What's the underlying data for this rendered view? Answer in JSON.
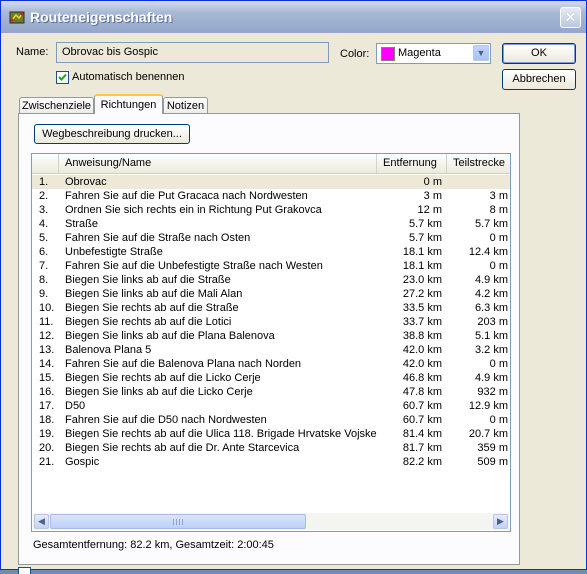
{
  "window": {
    "title": "Routeneigenschaften",
    "icon": "route-properties-icon",
    "close_icon": "close-icon"
  },
  "form": {
    "name_label": "Name:",
    "name_value": "Obrovac bis Gospic",
    "color_label": "Color:",
    "color_value": "Magenta",
    "color_swatch": "#ff00ff",
    "auto_name_label": "Automatisch benennen",
    "auto_name_checked": true
  },
  "buttons": {
    "ok": "OK",
    "cancel": "Abbrechen",
    "print": "Wegbeschreibung drucken..."
  },
  "tabs": [
    {
      "label": "Zwischenziele",
      "active": false
    },
    {
      "label": "Richtungen",
      "active": true
    },
    {
      "label": "Notizen",
      "active": false
    }
  ],
  "table": {
    "columns": [
      "Anweisung/Name",
      "Entfernung",
      "Teilstrecke"
    ],
    "rows": [
      {
        "num": "1.",
        "name": "Obrovac",
        "dist": "0 m",
        "leg": ""
      },
      {
        "num": "2.",
        "name": "Fahren Sie auf die Put Gracaca nach Nordwesten",
        "dist": "3 m",
        "leg": "3 m"
      },
      {
        "num": "3.",
        "name": "Ordnen Sie sich rechts ein in Richtung Put Grakovca",
        "dist": "12 m",
        "leg": "8 m"
      },
      {
        "num": "4.",
        "name": "Straße",
        "dist": "5.7 km",
        "leg": "5.7 km"
      },
      {
        "num": "5.",
        "name": "Fahren Sie auf die Straße nach Osten",
        "dist": "5.7 km",
        "leg": "0 m"
      },
      {
        "num": "6.",
        "name": "Unbefestigte Straße",
        "dist": "18.1 km",
        "leg": "12.4 km"
      },
      {
        "num": "7.",
        "name": "Fahren Sie auf die Unbefestigte Straße nach Westen",
        "dist": "18.1 km",
        "leg": "0 m"
      },
      {
        "num": "8.",
        "name": "Biegen Sie links ab auf die Straße",
        "dist": "23.0 km",
        "leg": "4.9 km"
      },
      {
        "num": "9.",
        "name": "Biegen Sie links ab auf die Mali Alan",
        "dist": "27.2 km",
        "leg": "4.2 km"
      },
      {
        "num": "10.",
        "name": "Biegen Sie rechts ab auf die Straße",
        "dist": "33.5 km",
        "leg": "6.3 km"
      },
      {
        "num": "11.",
        "name": "Biegen Sie rechts ab auf die Lotici",
        "dist": "33.7 km",
        "leg": "203 m"
      },
      {
        "num": "12.",
        "name": "Biegen Sie links ab auf die Plana Balenova",
        "dist": "38.8 km",
        "leg": "5.1 km"
      },
      {
        "num": "13.",
        "name": "Balenova Plana 5",
        "dist": "42.0 km",
        "leg": "3.2 km"
      },
      {
        "num": "14.",
        "name": "Fahren Sie auf die Balenova Plana nach Norden",
        "dist": "42.0 km",
        "leg": "0 m"
      },
      {
        "num": "15.",
        "name": "Biegen Sie rechts ab auf die Licko Cerje",
        "dist": "46.8 km",
        "leg": "4.9 km"
      },
      {
        "num": "16.",
        "name": "Biegen Sie links ab auf die Licko Cerje",
        "dist": "47.8 km",
        "leg": "932 m"
      },
      {
        "num": "17.",
        "name": "D50",
        "dist": "60.7 km",
        "leg": "12.9 km"
      },
      {
        "num": "18.",
        "name": "Fahren Sie auf die  D50 nach Nordwesten",
        "dist": "60.7 km",
        "leg": "0 m"
      },
      {
        "num": "19.",
        "name": "Biegen Sie rechts ab auf die Ulica 118. Brigade Hrvatske Vojske",
        "dist": "81.4 km",
        "leg": "20.7 km"
      },
      {
        "num": "20.",
        "name": "Biegen Sie rechts ab auf die Dr. Ante Starcevica",
        "dist": "81.7 km",
        "leg": "359 m"
      },
      {
        "num": "21.",
        "name": "Gospic",
        "dist": "82.2 km",
        "leg": "509 m"
      }
    ]
  },
  "status": "Gesamtentfernung: 82.2 km, Gesamtzeit: 2:00:45"
}
